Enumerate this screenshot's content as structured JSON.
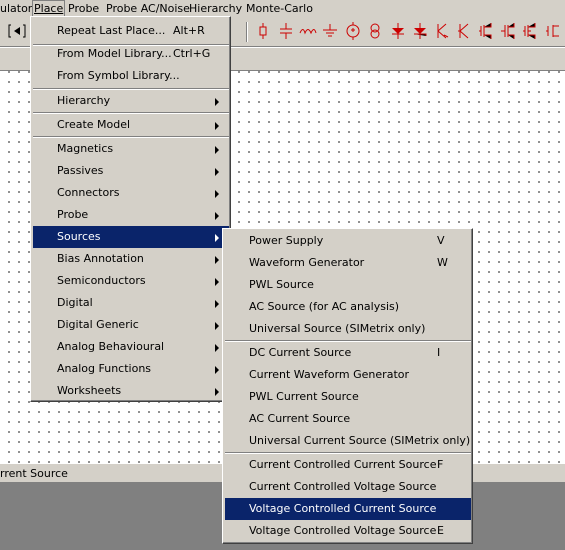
{
  "menubar": [
    {
      "label": "ulator"
    },
    {
      "label": "Place"
    },
    {
      "label": "Probe"
    },
    {
      "label": "Probe AC/Noise"
    },
    {
      "label": "Hierarchy"
    },
    {
      "label": "Monte-Carlo"
    }
  ],
  "place_menu": {
    "items": [
      {
        "label": "Repeat Last Place...",
        "shortcut": "Alt+R"
      },
      {
        "label": "From Model Library...",
        "shortcut": "Ctrl+G"
      },
      {
        "label": "From Symbol Library..."
      },
      {
        "label": "Hierarchy"
      },
      {
        "label": "Create Model"
      },
      {
        "label": "Magnetics"
      },
      {
        "label": "Passives"
      },
      {
        "label": "Connectors"
      },
      {
        "label": "Probe"
      },
      {
        "label": "Sources"
      },
      {
        "label": "Bias Annotation"
      },
      {
        "label": "Semiconductors"
      },
      {
        "label": "Digital"
      },
      {
        "label": "Digital Generic"
      },
      {
        "label": "Analog Behavioural"
      },
      {
        "label": "Analog Functions"
      },
      {
        "label": "Worksheets"
      }
    ]
  },
  "sources_menu": {
    "items": [
      {
        "label": "Power Supply",
        "shortcut": "V"
      },
      {
        "label": "Waveform Generator",
        "shortcut": "W"
      },
      {
        "label": "PWL Source"
      },
      {
        "label": "AC Source (for AC analysis)"
      },
      {
        "label": "Universal Source (SIMetrix only)"
      },
      {
        "label": "DC Current Source",
        "shortcut": "I"
      },
      {
        "label": "Current Waveform Generator"
      },
      {
        "label": "PWL Current Source"
      },
      {
        "label": "AC Current Source"
      },
      {
        "label": "Universal Current Source (SIMetrix only)"
      },
      {
        "label": "Current Controlled Current Source",
        "shortcut": "F"
      },
      {
        "label": "Current Controlled Voltage Source"
      },
      {
        "label": "Voltage Controlled Current Source"
      },
      {
        "label": "Voltage Controlled Voltage Source",
        "shortcut": "E"
      }
    ]
  },
  "status": {
    "text": "rrent Source"
  },
  "colors": {
    "highlight": "#0a246a",
    "toolbar_icons": "#cc0000",
    "face": "#d4d0c8"
  },
  "toolbar_icons": [
    "bracket-icon",
    "resistor-icon",
    "capacitor-icon",
    "inductor-icon",
    "ground-icon",
    "voltage-source-icon",
    "current-source-icon",
    "diode-icon",
    "zener-icon",
    "schottky-icon",
    "led-icon",
    "npn-icon",
    "pnp-icon",
    "nmos-icon",
    "pmos-icon",
    "jfet-icon"
  ]
}
